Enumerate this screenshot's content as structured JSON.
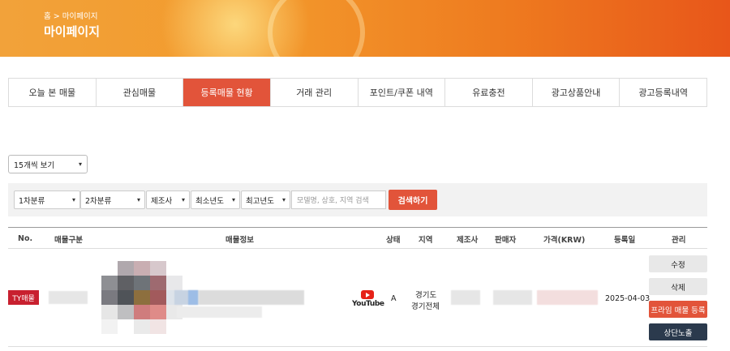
{
  "header": {
    "breadcrumb": "홈 > 마이페이지",
    "title": "마이페이지"
  },
  "tabs": [
    {
      "label": "오늘 본 매물"
    },
    {
      "label": "관심매물"
    },
    {
      "label": "등록매물 현황"
    },
    {
      "label": "거래 관리"
    },
    {
      "label": "포인트/쿠폰 내역"
    },
    {
      "label": "유료충전"
    },
    {
      "label": "광고상품안내"
    },
    {
      "label": "광고등록내역"
    }
  ],
  "active_tab": "등록매물 현황",
  "per_page": {
    "selected": "15개씩 보기"
  },
  "filters": {
    "category1": "1차분류",
    "category2": "2차분류",
    "maker": "제조사",
    "min_year": "최소년도",
    "max_year": "최고년도",
    "search_placeholder": "모델명, 상호, 지역 검색",
    "search_button": "검색하기"
  },
  "table": {
    "headers": [
      "No.",
      "매물구분",
      "매물정보",
      "상태",
      "지역",
      "제조사",
      "판매자",
      "가격(KRW)",
      "등록일",
      "관리"
    ],
    "rows": [
      {
        "badge": "TY매물",
        "video": "YouTube",
        "status": "A",
        "region_line1": "경기도",
        "region_line2": "경기전체",
        "date": "2025-04-03",
        "actions": {
          "edit": "수정",
          "delete": "삭제",
          "premium": "프라임 매물 등록",
          "top": "상단노출"
        }
      }
    ]
  },
  "colors": {
    "accent": "#e2543a",
    "navy": "#2b3a4d",
    "badge": "#c8202f"
  }
}
